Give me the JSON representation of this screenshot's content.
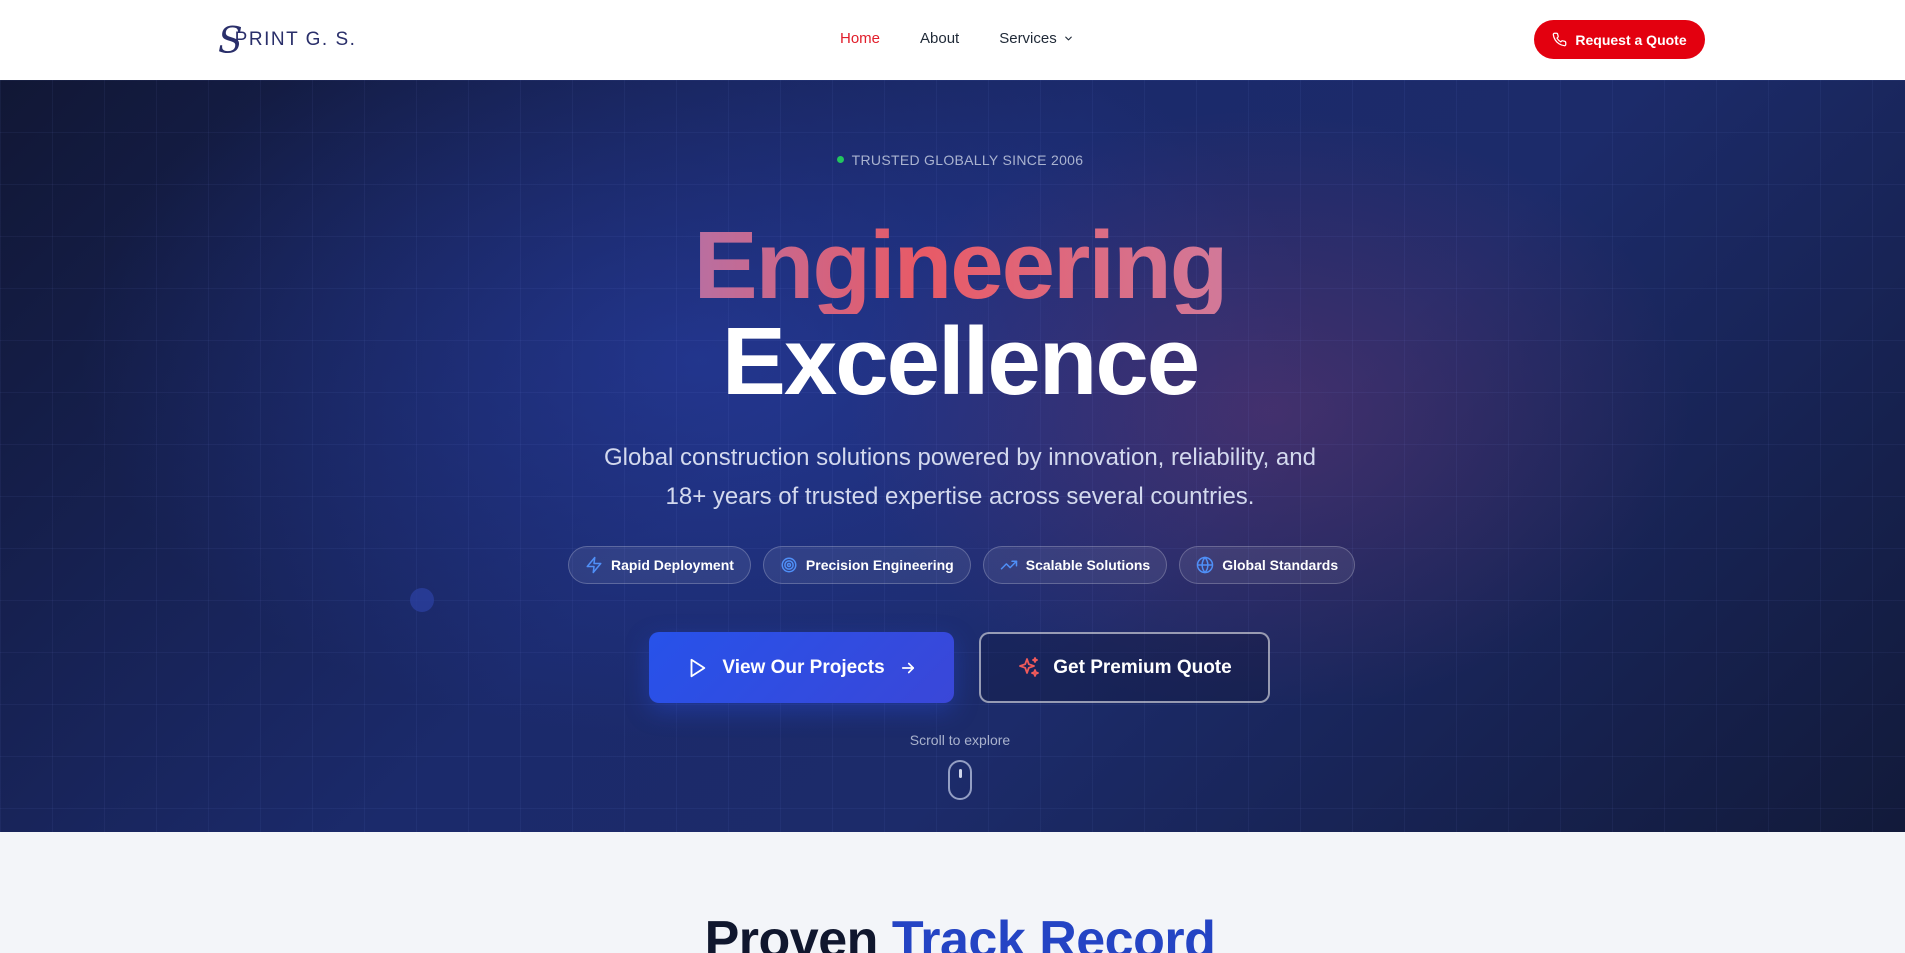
{
  "nav": {
    "logo_mark": "S",
    "logo_text": "PRINT G. S.",
    "links": [
      "Home",
      "About",
      "Services"
    ],
    "active": "Home",
    "quote_button": "Request a Quote"
  },
  "hero": {
    "badge": "TRUSTED GLOBALLY SINCE 2006",
    "title_line1": "Engineering",
    "title_line2": "Excellence",
    "subtitle_line1": "Global construction solutions powered by innovation, reliability, and",
    "subtitle_line2": "18+ years of trusted expertise across several countries.",
    "features": [
      {
        "label": "Rapid Deployment",
        "icon": "lightning-icon"
      },
      {
        "label": "Precision Engineering",
        "icon": "target-icon"
      },
      {
        "label": "Scalable Solutions",
        "icon": "trending-up-icon"
      },
      {
        "label": "Global Standards",
        "icon": "globe-icon"
      }
    ],
    "primary_button": "View Our Projects",
    "secondary_button": "Get Premium Quote",
    "scroll_hint": "Scroll to explore"
  },
  "records": {
    "heading_part1": "Proven",
    "heading_part2": "Track Record"
  },
  "colors": {
    "brand_red": "#e3000f",
    "hero_dark": "#1b2a6b",
    "accent_blue": "#2752ea",
    "badge_green": "#22c55e"
  }
}
